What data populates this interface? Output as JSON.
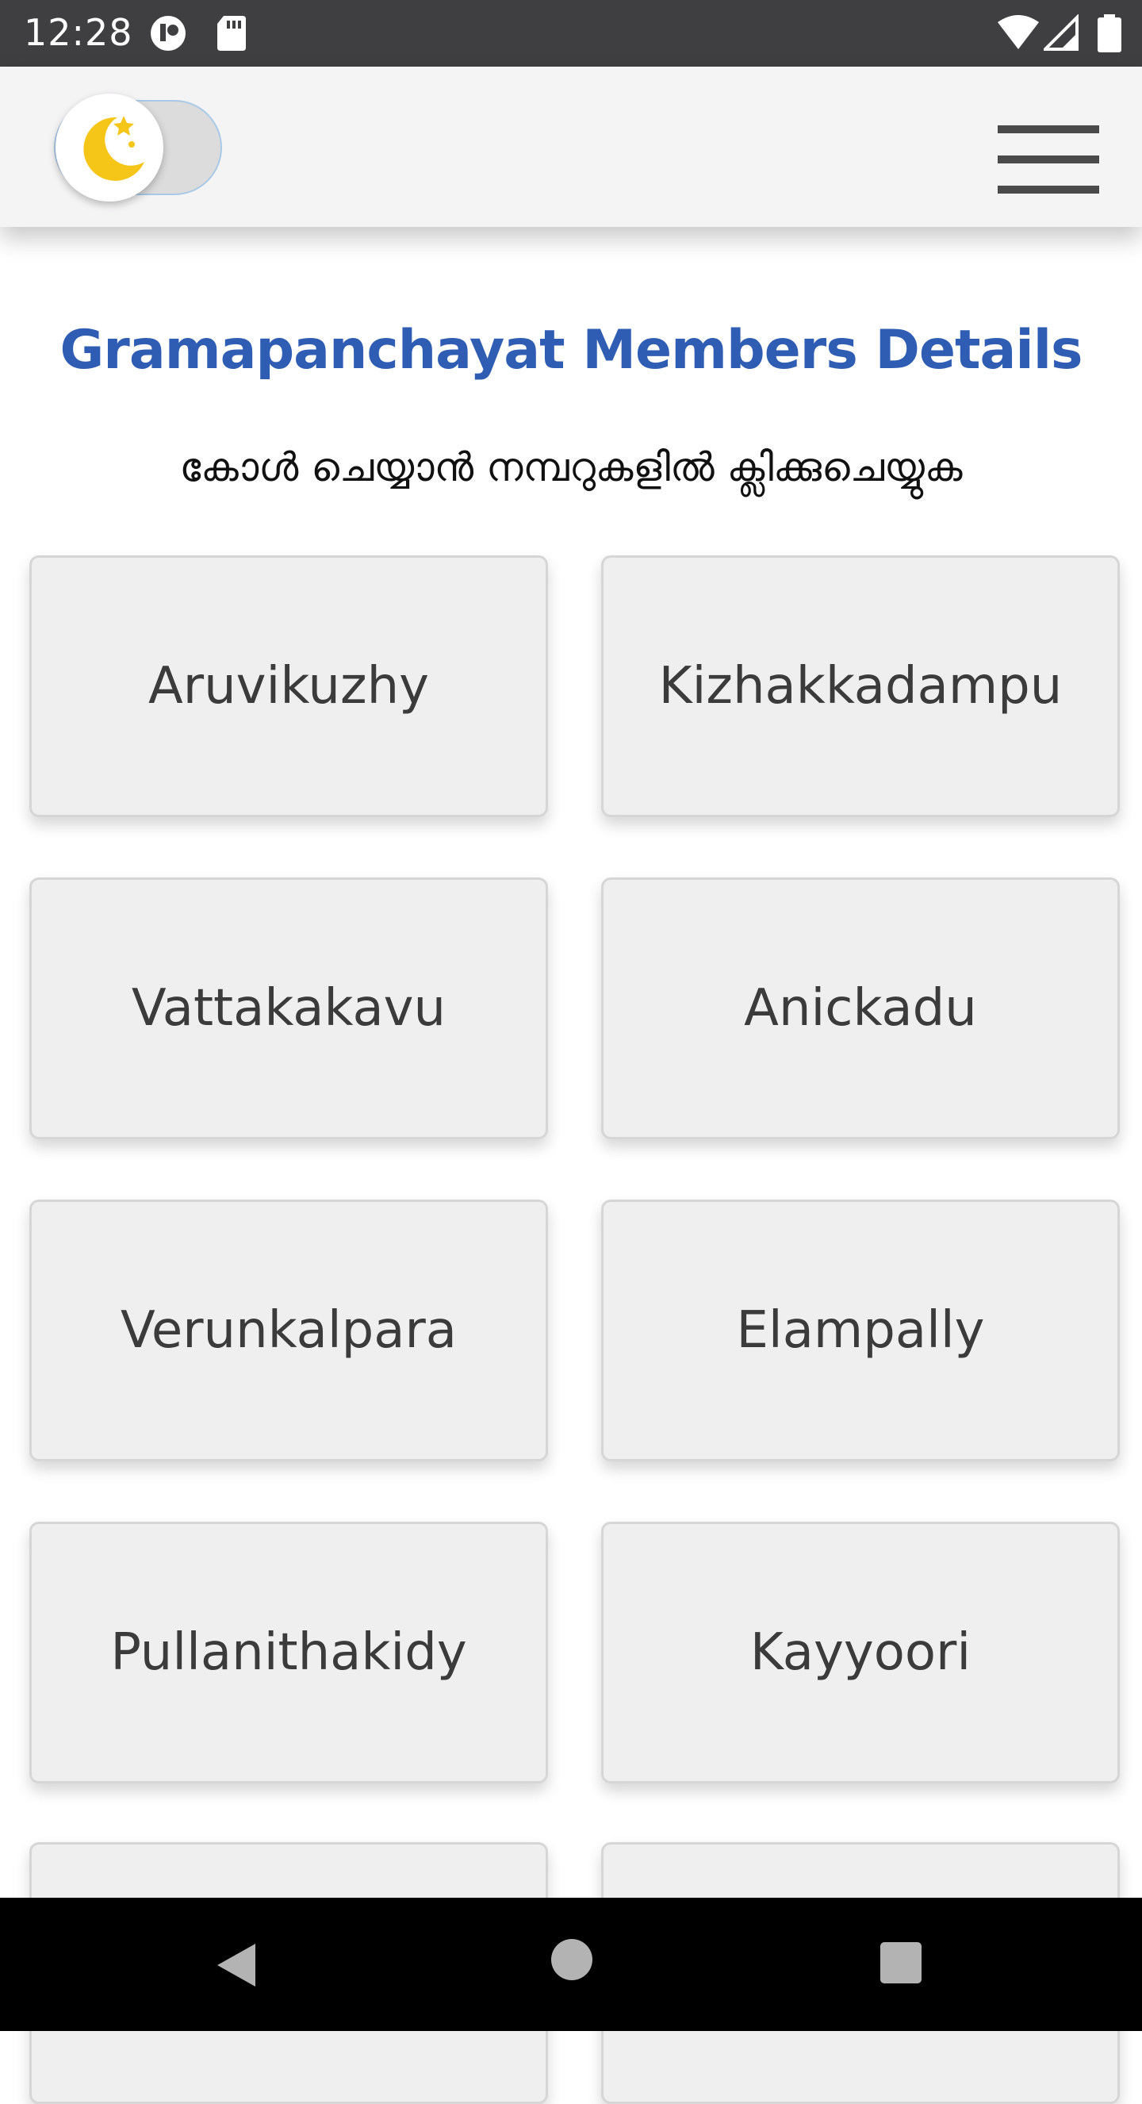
{
  "status_bar": {
    "time": "12:28"
  },
  "header": {
    "theme_toggle_state": "night",
    "menu_icon": "hamburger-menu-icon"
  },
  "main": {
    "title": "Gramapanchayat Members Details",
    "instruction": "കോൾ ചെയ്യാൻ നമ്പറുകളിൽ ക്ലിക്കുചെയ്യുക",
    "wards": [
      {
        "label": "Aruvikuzhy"
      },
      {
        "label": "Kizhakkadampu"
      },
      {
        "label": "Vattakakavu"
      },
      {
        "label": "Anickadu"
      },
      {
        "label": "Verunkalpara"
      },
      {
        "label": "Elampally"
      },
      {
        "label": "Pullanithakidy"
      },
      {
        "label": "Kayyoori"
      }
    ]
  },
  "colors": {
    "title": "#2f5db3",
    "status_bar": "#3f3f41",
    "header_bg": "#f5f4f5",
    "card_bg": "#efefef",
    "moon": "#f5c518"
  }
}
